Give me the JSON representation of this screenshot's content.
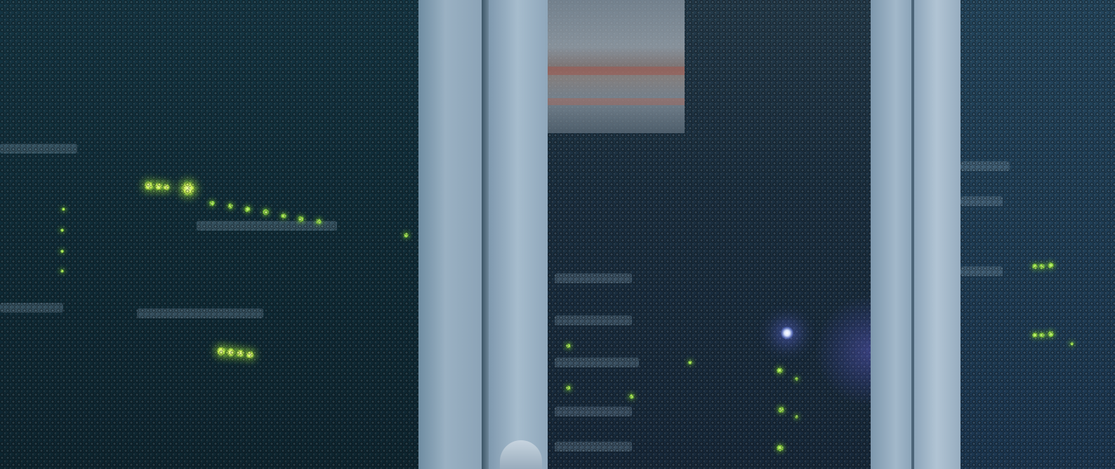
{
  "scene": {
    "subject": "server-racks",
    "colors": {
      "led_green": "#c8f050",
      "led_blue": "#dbe6ff",
      "frame": "#9ab1c3",
      "mesh_dark": "#0f2c38"
    }
  }
}
